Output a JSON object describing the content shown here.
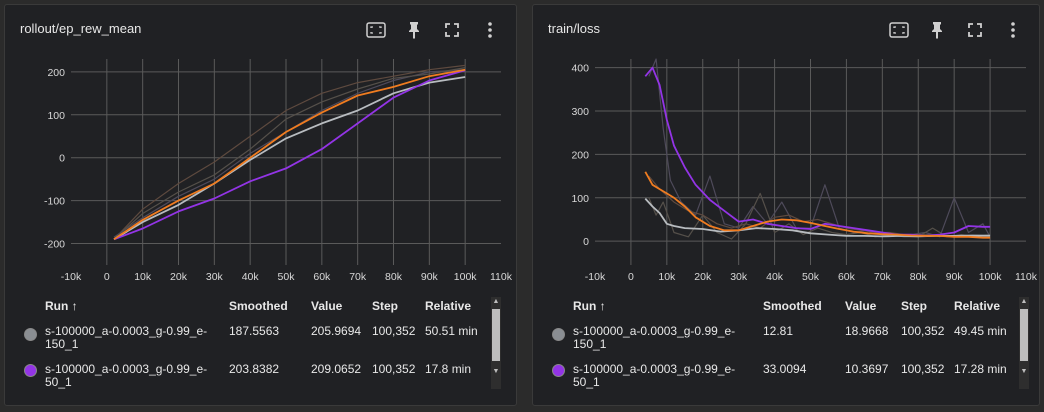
{
  "colors": {
    "grey_run": "#b8bcc0",
    "purple_run": "#9334e6",
    "orange_run": "#f07c20",
    "faint_runs": [
      "#5e4a3f",
      "#4e4a5a",
      "#55504a",
      "#4a4646"
    ]
  },
  "toolbar_icons": [
    "fit-domain-icon",
    "pin-icon",
    "fullscreen-icon",
    "more-vert-icon"
  ],
  "table_headers": {
    "run": "Run ↑",
    "smoothed": "Smoothed",
    "value": "Value",
    "step": "Step",
    "relative": "Relative"
  },
  "panel1": {
    "title": "rollout/ep_rew_mean",
    "rows": [
      {
        "name_line1": "s-100000_a-0.0003_g-0.99_e-",
        "name_line2": "150_1",
        "smoothed": "187.5563",
        "value": "205.9694",
        "step": "100,352",
        "relative": "50.51 min",
        "color": "#b8bcc0"
      },
      {
        "name_line1": "s-100000_a-0.0003_g-0.99_e-",
        "name_line2": "50_1",
        "smoothed": "203.8382",
        "value": "209.0652",
        "step": "100,352",
        "relative": "17.8 min",
        "color": "#9334e6"
      }
    ]
  },
  "panel2": {
    "title": "train/loss",
    "rows": [
      {
        "name_line1": "s-100000_a-0.0003_g-0.99_e-",
        "name_line2": "150_1",
        "smoothed": "12.81",
        "value": "18.9668",
        "step": "100,352",
        "relative": "49.45 min",
        "color": "#b8bcc0"
      },
      {
        "name_line1": "s-100000_a-0.0003_g-0.99_e-",
        "name_line2": "50_1",
        "smoothed": "33.0094",
        "value": "10.3697",
        "step": "100,352",
        "relative": "17.28 min",
        "color": "#9334e6"
      }
    ]
  },
  "chart_data": [
    {
      "type": "line",
      "title": "rollout/ep_rew_mean",
      "xlim": [
        -10000,
        110000
      ],
      "ylim": [
        -250,
        230
      ],
      "xticks": [
        -10000,
        0,
        10000,
        20000,
        30000,
        40000,
        50000,
        60000,
        70000,
        80000,
        90000,
        100000,
        110000
      ],
      "xtick_labels": [
        "-10k",
        "0",
        "10k",
        "20k",
        "30k",
        "40k",
        "50k",
        "60k",
        "70k",
        "80k",
        "90k",
        "100k",
        "110k"
      ],
      "yticks": [
        -200,
        -100,
        0,
        100,
        200
      ],
      "ytick_labels": [
        "-200",
        "-100",
        "0",
        "100",
        "200"
      ],
      "grid": true,
      "series": [
        {
          "color": "#5e4a3f",
          "x": [
            2000,
            10000,
            20000,
            30000,
            40000,
            50000,
            60000,
            70000,
            80000,
            90000,
            100000
          ],
          "y": [
            -190,
            -120,
            -60,
            -10,
            50,
            110,
            150,
            175,
            190,
            205,
            215
          ]
        },
        {
          "color": "#4e4a5a",
          "x": [
            2000,
            10000,
            20000,
            30000,
            40000,
            50000,
            60000,
            70000,
            80000,
            90000,
            100000
          ],
          "y": [
            -185,
            -140,
            -90,
            -50,
            10,
            60,
            110,
            150,
            180,
            200,
            205
          ]
        },
        {
          "color": "#55504a",
          "x": [
            2000,
            10000,
            20000,
            30000,
            40000,
            50000,
            60000,
            70000,
            80000,
            90000,
            100000
          ],
          "y": [
            -190,
            -130,
            -80,
            -40,
            20,
            90,
            130,
            160,
            185,
            195,
            210
          ]
        },
        {
          "color": "#b8bcc0",
          "x": [
            2000,
            10000,
            20000,
            30000,
            40000,
            50000,
            60000,
            70000,
            80000,
            90000,
            100000
          ],
          "y": [
            -190,
            -150,
            -110,
            -60,
            -5,
            45,
            80,
            110,
            150,
            175,
            188
          ]
        },
        {
          "color": "#9334e6",
          "x": [
            2000,
            10000,
            20000,
            30000,
            40000,
            50000,
            60000,
            70000,
            80000,
            90000,
            100000
          ],
          "y": [
            -190,
            -165,
            -125,
            -95,
            -55,
            -25,
            20,
            80,
            140,
            180,
            204
          ]
        },
        {
          "color": "#f07c20",
          "x": [
            2000,
            10000,
            20000,
            30000,
            40000,
            50000,
            60000,
            70000,
            80000,
            90000,
            100000
          ],
          "y": [
            -190,
            -145,
            -100,
            -60,
            0,
            60,
            105,
            145,
            165,
            190,
            205
          ]
        }
      ]
    },
    {
      "type": "line",
      "title": "train/loss",
      "xlim": [
        -10000,
        110000
      ],
      "ylim": [
        -55,
        420
      ],
      "xticks": [
        -10000,
        0,
        10000,
        20000,
        30000,
        40000,
        50000,
        60000,
        70000,
        80000,
        90000,
        100000,
        110000
      ],
      "xtick_labels": [
        "-10k",
        "0",
        "10k",
        "20k",
        "30k",
        "40k",
        "50k",
        "60k",
        "70k",
        "80k",
        "90k",
        "100k",
        "110k"
      ],
      "yticks": [
        0,
        100,
        200,
        300,
        400
      ],
      "ytick_labels": [
        "0",
        "100",
        "200",
        "300",
        "400"
      ],
      "grid": true,
      "series": [
        {
          "color": "#4e4a5a",
          "x": [
            5000,
            7000,
            9000,
            11000,
            14000,
            18000,
            22000,
            26000,
            30000,
            34000,
            38000,
            42000,
            46000,
            50000,
            54000,
            58000,
            62000,
            66000,
            70000,
            74000,
            78000,
            82000,
            86000,
            90000,
            94000,
            98000,
            100000
          ],
          "y": [
            380,
            420,
            260,
            140,
            90,
            60,
            150,
            40,
            30,
            80,
            40,
            90,
            30,
            30,
            130,
            30,
            20,
            25,
            20,
            15,
            15,
            20,
            10,
            100,
            20,
            40,
            10
          ]
        },
        {
          "color": "#55504a",
          "x": [
            5000,
            7000,
            9000,
            12000,
            16000,
            20000,
            24000,
            28000,
            32000,
            36000,
            40000,
            44000,
            48000,
            52000,
            56000,
            60000,
            64000,
            68000,
            72000,
            76000,
            80000,
            84000,
            88000,
            92000,
            96000,
            100000
          ],
          "y": [
            100,
            60,
            90,
            20,
            10,
            60,
            20,
            5,
            40,
            110,
            20,
            40,
            15,
            30,
            20,
            15,
            20,
            10,
            15,
            10,
            10,
            30,
            10,
            15,
            10,
            15
          ]
        },
        {
          "color": "#5e4a3f",
          "x": [
            5000,
            8000,
            12000,
            16000,
            20000,
            24000,
            28000,
            32000,
            36000,
            40000,
            44000,
            48000,
            52000,
            56000,
            60000,
            64000,
            68000,
            72000,
            76000,
            80000,
            84000,
            88000,
            92000,
            96000,
            100000
          ],
          "y": [
            150,
            120,
            90,
            70,
            60,
            40,
            30,
            40,
            30,
            55,
            60,
            45,
            50,
            40,
            30,
            25,
            20,
            20,
            15,
            15,
            15,
            12,
            12,
            10,
            10
          ]
        },
        {
          "color": "#b8bcc0",
          "x": [
            4000,
            6000,
            8000,
            10000,
            12000,
            15000,
            20000,
            25000,
            30000,
            35000,
            40000,
            45000,
            50000,
            55000,
            60000,
            65000,
            70000,
            75000,
            80000,
            85000,
            90000,
            95000,
            100000
          ],
          "y": [
            98,
            80,
            65,
            40,
            35,
            30,
            28,
            22,
            25,
            30,
            28,
            25,
            18,
            15,
            12,
            12,
            11,
            12,
            11,
            12,
            12,
            13,
            12.8
          ]
        },
        {
          "color": "#9334e6",
          "x": [
            4000,
            6000,
            8000,
            10000,
            12000,
            15000,
            18000,
            22000,
            26000,
            30000,
            34000,
            38000,
            42000,
            46000,
            50000,
            54000,
            58000,
            62000,
            66000,
            70000,
            74000,
            78000,
            82000,
            86000,
            90000,
            94000,
            98000,
            100000
          ],
          "y": [
            380,
            400,
            360,
            280,
            220,
            170,
            130,
            95,
            70,
            45,
            50,
            40,
            35,
            30,
            28,
            40,
            35,
            30,
            25,
            20,
            15,
            15,
            12,
            15,
            20,
            35,
            33,
            33
          ]
        },
        {
          "color": "#f07c20",
          "x": [
            4000,
            6000,
            8000,
            10000,
            12000,
            15000,
            18000,
            22000,
            26000,
            30000,
            34000,
            38000,
            42000,
            46000,
            50000,
            54000,
            58000,
            62000,
            66000,
            70000,
            74000,
            78000,
            82000,
            86000,
            90000,
            94000,
            98000,
            100000
          ],
          "y": [
            160,
            130,
            120,
            110,
            100,
            80,
            55,
            35,
            25,
            25,
            35,
            45,
            50,
            48,
            42,
            35,
            28,
            22,
            18,
            16,
            15,
            13,
            12,
            12,
            10,
            10,
            8,
            8
          ]
        }
      ]
    }
  ]
}
